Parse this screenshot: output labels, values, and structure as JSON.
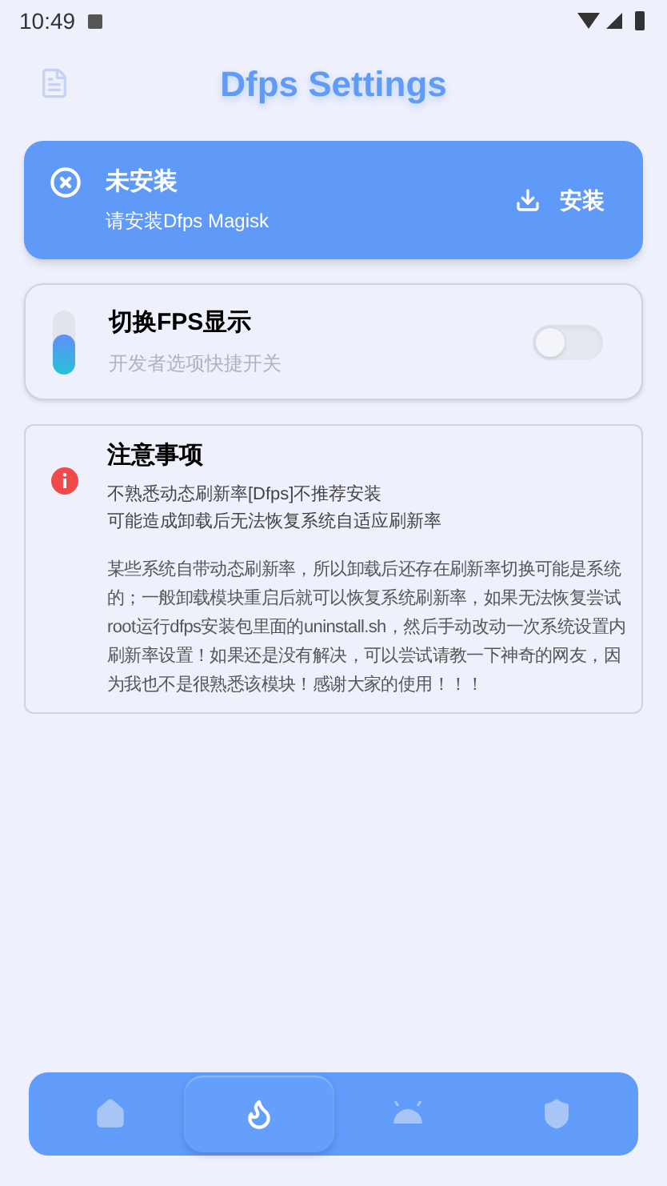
{
  "status_bar": {
    "time": "10:49"
  },
  "header": {
    "title": "Dfps Settings"
  },
  "install_card": {
    "title": "未安装",
    "subtitle": "请安装Dfps Magisk",
    "action": "安装"
  },
  "fps_card": {
    "title": "切换FPS显示",
    "subtitle": "开发者选项快捷开关",
    "on": false
  },
  "notice": {
    "title": "注意事项",
    "lines": [
      "不熟悉动态刷新率[Dfps]不推荐安装",
      "可能造成卸载后无法恢复系统自适应刷新率"
    ],
    "body": "某些系统自带动态刷新率，所以卸载后还存在刷新率切换可能是系统的；一般卸载模块重启后就可以恢复系统刷新率，如果无法恢复尝试root运行dfps安装包里面的uninstall.sh，然后手动改动一次系统设置内刷新率设置！如果还是没有解决，可以尝试请教一下神奇的网友，因为我也不是很熟悉该模块！感谢大家的使用！！！"
  },
  "nav": [
    {
      "kind": "home",
      "selected": false
    },
    {
      "kind": "flame",
      "selected": true
    },
    {
      "kind": "android",
      "selected": false
    },
    {
      "kind": "shield",
      "selected": false
    }
  ]
}
